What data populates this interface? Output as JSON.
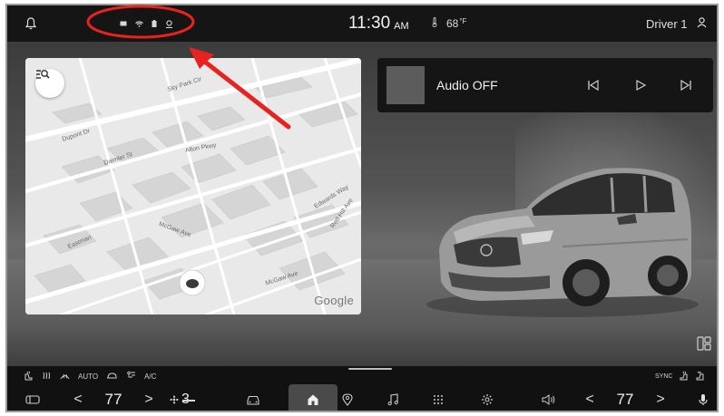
{
  "status_bar": {
    "time": "11:30",
    "ampm": "AM",
    "temperature": "68",
    "temperature_unit": "°F",
    "driver": "Driver 1",
    "icons": [
      "bell-icon",
      "message-icon",
      "wifi-icon",
      "battery-icon",
      "location-share-icon",
      "thermometer-icon",
      "person-icon"
    ]
  },
  "annotation": {
    "color": "#e8231f"
  },
  "map": {
    "logo": "Google",
    "streets": [
      "McGaw Ave",
      "Eastman",
      "Edwards Way",
      "Red Hill Ave",
      "Alton Pkwy",
      "Daimler St",
      "Dupont Dr",
      "McGaw Ave",
      "Sky Park Cir"
    ]
  },
  "audio": {
    "title": "Audio OFF"
  },
  "climate": {
    "auto_label": "AUTO",
    "ac_label": "A/C",
    "sync_label": "SYNC",
    "left_temp": "77",
    "right_temp": "77",
    "fan_level": "3",
    "left_arrow": "<",
    "right_arrow": ">"
  },
  "colors": {
    "screen_bg": "#1c1c1c",
    "accent_red": "#e8231f",
    "map_bg": "#e9e9e9"
  }
}
